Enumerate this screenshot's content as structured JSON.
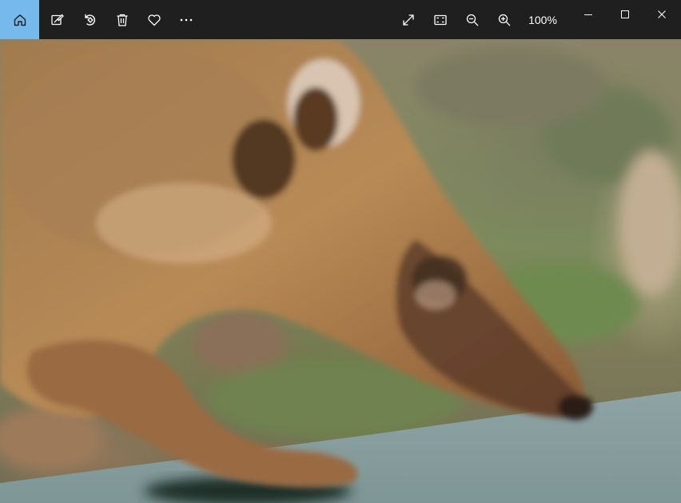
{
  "toolbar": {
    "zoom_level": "100%",
    "accent_color": "#76b9ed",
    "left_icons": [
      "home-icon",
      "edit-icon",
      "rotate-icon",
      "delete-icon",
      "favorite-icon",
      "more-icon"
    ],
    "right_icons": [
      "fullscreen-icon",
      "actual-size-icon",
      "zoom-out-icon",
      "zoom-in-icon"
    ]
  },
  "window_controls": [
    "minimize-icon",
    "maximize-icon",
    "close-icon"
  ],
  "photo": {
    "subject": "coati"
  }
}
